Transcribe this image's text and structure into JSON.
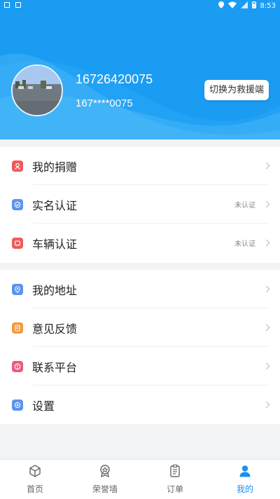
{
  "status_bar": {
    "time": "8:53"
  },
  "profile": {
    "name": "16726420075",
    "phone_masked": "167****0075",
    "switch_label": "切换为救援端"
  },
  "menu_group_1": [
    {
      "label": "我的捐赠",
      "icon": "donation-icon",
      "color": "#f05a5a",
      "status": ""
    },
    {
      "label": "实名认证",
      "icon": "verify-icon",
      "color": "#5b93f0",
      "status": "未认证"
    },
    {
      "label": "车辆认证",
      "icon": "car-icon",
      "color": "#f05a5a",
      "status": "未认证"
    }
  ],
  "menu_group_2": [
    {
      "label": "我的地址",
      "icon": "location-icon",
      "color": "#5b93f0"
    },
    {
      "label": "意见反馈",
      "icon": "feedback-icon",
      "color": "#f39a3b"
    },
    {
      "label": "联系平台",
      "icon": "contact-icon",
      "color": "#ef5a7e"
    },
    {
      "label": "设置",
      "icon": "settings-icon",
      "color": "#5b93f0"
    }
  ],
  "tabs": [
    {
      "label": "首页",
      "icon": "home-box-icon"
    },
    {
      "label": "荣誉墙",
      "icon": "medal-icon"
    },
    {
      "label": "订单",
      "icon": "clipboard-icon"
    },
    {
      "label": "我的",
      "icon": "user-icon",
      "active": true
    }
  ],
  "colors": {
    "brand": "#1a9cf2",
    "active_tab": "#1a8ff0"
  }
}
